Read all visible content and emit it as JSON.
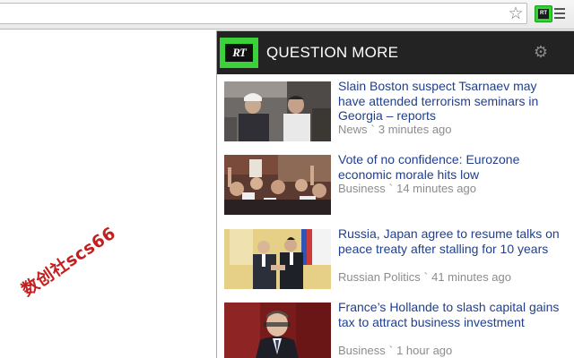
{
  "toolbar": {
    "star_icon": "☆",
    "extension_label": "RT",
    "menu_icon": "menu-icon"
  },
  "popup": {
    "logo_text": "RT",
    "title": "QUESTION MORE",
    "settings_icon": "⚙",
    "items": [
      {
        "headline": "Slain Boston suspect Tsarnaev may have attended terrorism seminars in Georgia – reports",
        "category": "News",
        "separator": "`",
        "time": "3 minutes ago"
      },
      {
        "headline": "Vote of no confidence: Eurozone economic morale hits low",
        "category": "Business",
        "separator": "`",
        "time": "14 minutes ago"
      },
      {
        "headline": "Russia, Japan agree to resume talks on peace treaty after stalling for 10 years",
        "category": "Russian Politics",
        "separator": "`",
        "time": "41 minutes ago"
      },
      {
        "headline": "France’s Hollande to slash capital gains tax to attract business investment",
        "category": "Business",
        "separator": "`",
        "time": "1 hour ago"
      }
    ]
  },
  "watermark": "数创社scs66",
  "colors": {
    "brand_green": "#3ad13a",
    "header_bg": "#232323",
    "link_blue": "#1f3f8f",
    "meta_gray": "#8c8c8c"
  }
}
